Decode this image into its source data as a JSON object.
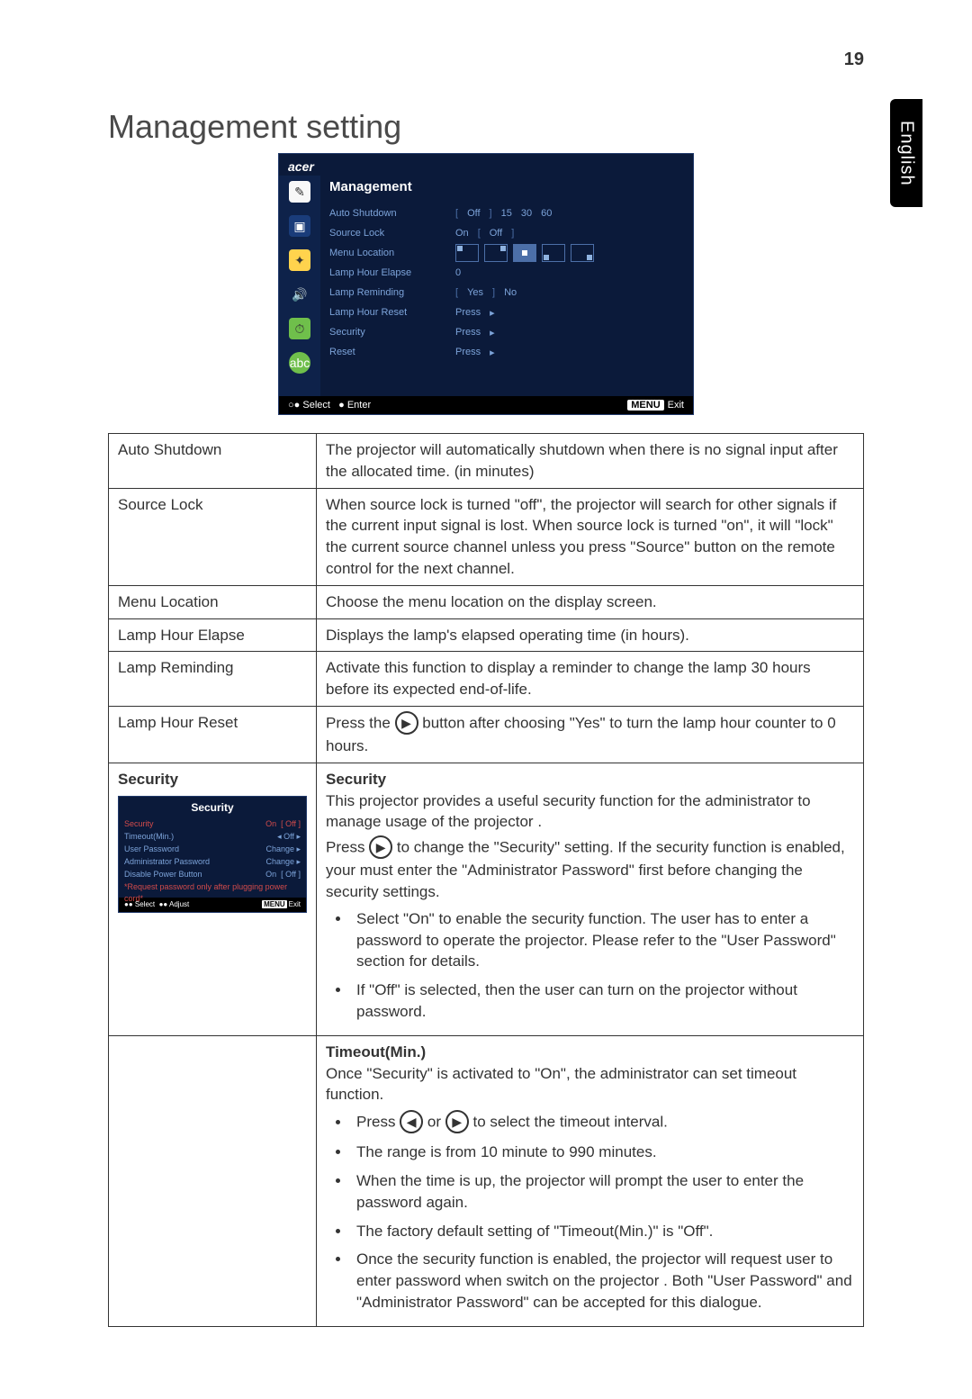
{
  "page": {
    "number": "19",
    "language": "English",
    "title": "Management setting"
  },
  "osd": {
    "brand": "acer",
    "heading": "Management",
    "rows": {
      "autoShutdown": {
        "label": "Auto Shutdown",
        "v1": "Off",
        "v2": "15",
        "v3": "30",
        "v4": "60"
      },
      "sourceLock": {
        "label": "Source Lock",
        "v1": "On",
        "v2": "Off"
      },
      "menuLocation": {
        "label": "Menu Location"
      },
      "lampElapse": {
        "label": "Lamp Hour Elapse",
        "v1": "0"
      },
      "lampRemind": {
        "label": "Lamp Reminding",
        "v1": "Yes",
        "v2": "No"
      },
      "lampReset": {
        "label": "Lamp Hour Reset",
        "v1": "Press",
        "arrow": "▸"
      },
      "security": {
        "label": "Security",
        "v1": "Press",
        "arrow": "▸"
      },
      "reset": {
        "label": "Reset",
        "v1": "Press",
        "arrow": "▸"
      }
    },
    "footer": {
      "select": "Select",
      "enter": "Enter",
      "menu": "MENU",
      "exit": "Exit",
      "sel": "○●",
      "ent": "●"
    }
  },
  "table": {
    "autoShutdown": {
      "l": "Auto Shutdown",
      "r": "The projector will automatically shutdown when there is no signal input after the allocated time. (in minutes)"
    },
    "sourceLock": {
      "l": "Source Lock",
      "r": "When source lock is turned \"off\", the projector will search for other signals if the current input signal is lost. When source lock is turned \"on\", it will \"lock\" the current source channel unless you press \"Source\" button on the remote control for the next channel."
    },
    "menuLocation": {
      "l": "Menu Location",
      "r": "Choose the menu location on the display screen."
    },
    "lampElapse": {
      "l": "Lamp Hour Elapse",
      "r": "Displays the lamp's elapsed operating time (in hours)."
    },
    "lampRemind": {
      "l": "Lamp Reminding",
      "r": "Activate this function to display a reminder to change the lamp 30 hours before its expected end-of-life."
    },
    "lampReset": {
      "l": "Lamp Hour Reset",
      "r_a": "Press the ",
      "r_b": " button after choosing \"Yes\" to turn the lamp hour counter to 0 hours."
    },
    "security": {
      "l": "Security",
      "title": "Security",
      "intro": "This projector provides a useful security function for the administrator to manage usage of the projector .",
      "press_a": "Press ",
      "press_b": " to change the \"Security\" setting. If the security function is enabled, your must enter the \"Administrator Password\" first before changing the security settings.",
      "b1": "Select \"On\" to enable the security function. The user has to enter a password to operate the projector. Please refer to the \"User Password\" section for details.",
      "b2": "If \"Off\" is selected, then the user can turn on the projector without password."
    },
    "timeout": {
      "title": "Timeout(Min.)",
      "intro": "Once \"Security\" is activated to \"On\", the administrator can set timeout function.",
      "b1_a": "Press ",
      "b1_mid": " or ",
      "b1_b": " to select the timeout interval.",
      "b2": "The range is from 10 minute to 990 minutes.",
      "b3": "When the time is up, the projector will prompt the user to enter the password again.",
      "b4": "The factory default setting of \"Timeout(Min.)\" is \"Off\".",
      "b5": "Once the security function is enabled, the projector will request user to enter password when switch on the projector . Both \"User Password\" and \"Administrator Password\" can be accepted for this dialogue."
    }
  },
  "secOsd": {
    "title": "Security",
    "r1": {
      "a": "Security",
      "b": "On",
      "c": "Off"
    },
    "r2": {
      "a": "Timeout(Min.)",
      "b": "Off"
    },
    "r3": {
      "a": "User Password",
      "b": "Change ▸"
    },
    "r4": {
      "a": "Administrator Password",
      "b": "Change ▸"
    },
    "r5": {
      "a": "Disable Power Button",
      "b": "On",
      "c": "Off"
    },
    "note": "*Request password only after plugging power cord*",
    "foot": {
      "a": "Select",
      "b": "Adjust",
      "c": "MENU",
      "d": "Exit"
    }
  }
}
